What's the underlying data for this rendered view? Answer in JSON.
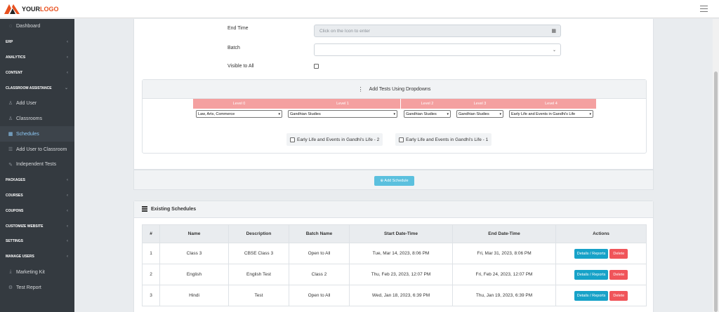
{
  "header": {
    "logo_part1": "YOUR",
    "logo_part2": "LOGO",
    "brand_color": "#e8501f"
  },
  "sidebar": {
    "items": [
      {
        "label": "Dashboard",
        "type": "sub",
        "icon": "circle-icon"
      },
      {
        "label": "ERP",
        "type": "hdr",
        "chevron": "‹"
      },
      {
        "label": "ANALYTICS",
        "type": "hdr",
        "chevron": "‹"
      },
      {
        "label": "CONTENT",
        "type": "hdr",
        "chevron": "‹"
      },
      {
        "label": "CLASSROOM ASSISTANCE",
        "type": "hdr",
        "chevron": "⌄"
      },
      {
        "label": "Add User",
        "type": "sub",
        "icon": "user-icon"
      },
      {
        "label": "Classrooms",
        "type": "sub",
        "icon": "users-icon"
      },
      {
        "label": "Schedules",
        "type": "sub",
        "icon": "calendar-icon",
        "active": true
      },
      {
        "label": "Add User to Classroom",
        "type": "sub",
        "icon": "list-icon"
      },
      {
        "label": "Independent Tests",
        "type": "sub",
        "icon": "edit-icon"
      },
      {
        "label": "PACKAGES",
        "type": "hdr",
        "chevron": "‹"
      },
      {
        "label": "COURSES",
        "type": "hdr",
        "chevron": "‹"
      },
      {
        "label": "COUPONS",
        "type": "hdr",
        "chevron": "‹"
      },
      {
        "label": "CUSTOMIZE WEBSITE",
        "type": "hdr",
        "chevron": "‹"
      },
      {
        "label": "SETTINGS",
        "type": "hdr",
        "chevron": "‹"
      },
      {
        "label": "MANAGE USERS",
        "type": "hdr",
        "chevron": "‹"
      },
      {
        "label": "Marketing Kit",
        "type": "sub",
        "icon": "download-icon"
      },
      {
        "label": "Test Report",
        "type": "sub",
        "icon": "gear-icon"
      }
    ]
  },
  "form": {
    "end_time_label": "End Time",
    "end_time_placeholder": "Click on the Icon to enter",
    "batch_label": "Batch",
    "batch_value": "",
    "visible_label": "Visible to All",
    "visible_checked": false
  },
  "tests": {
    "header": "Add Tests Using Dropdowns",
    "levels": [
      {
        "label": "Level 0",
        "value": "Law, Arts, Commerce"
      },
      {
        "label": "Level 1",
        "value": "Gandhian Studies"
      },
      {
        "label": "Level 2",
        "value": "Gandhian Studies"
      },
      {
        "label": "Level 3",
        "value": "Gandhian Studies"
      },
      {
        "label": "Level 4",
        "value": "Early Life and Events in Gandhi's Life"
      }
    ],
    "options": [
      "Early Life and Events in Gandhi's Life - 2",
      "Early Life and Events in Gandhi's Life - 1"
    ]
  },
  "add_schedule_label": "⊕ Add Schedule",
  "existing": {
    "title": "Existing Schedules",
    "columns": [
      "#",
      "Name",
      "Description",
      "Batch Name",
      "Start Date-Time",
      "End Date-Time",
      "Actions"
    ],
    "rows": [
      {
        "num": "1",
        "name": "Class 3",
        "description": "CBSE Class 3",
        "batch": "Open to All",
        "start": "Tue, Mar 14, 2023, 8:06 PM",
        "end": "Fri, Mar 31, 2023, 8:06 PM"
      },
      {
        "num": "2",
        "name": "English",
        "description": "English Test",
        "batch": "Class 2",
        "start": "Thu, Feb 23, 2023, 12:07 PM",
        "end": "Fri, Feb 24, 2023, 12:07 PM"
      },
      {
        "num": "3",
        "name": "Hindi",
        "description": "Test",
        "batch": "Open to All",
        "start": "Wed, Jan 18, 2023, 6:39 PM",
        "end": "Thu, Jan 19, 2023, 6:39 PM"
      }
    ],
    "details_label": "Details / Reports",
    "delete_label": "Delete"
  }
}
